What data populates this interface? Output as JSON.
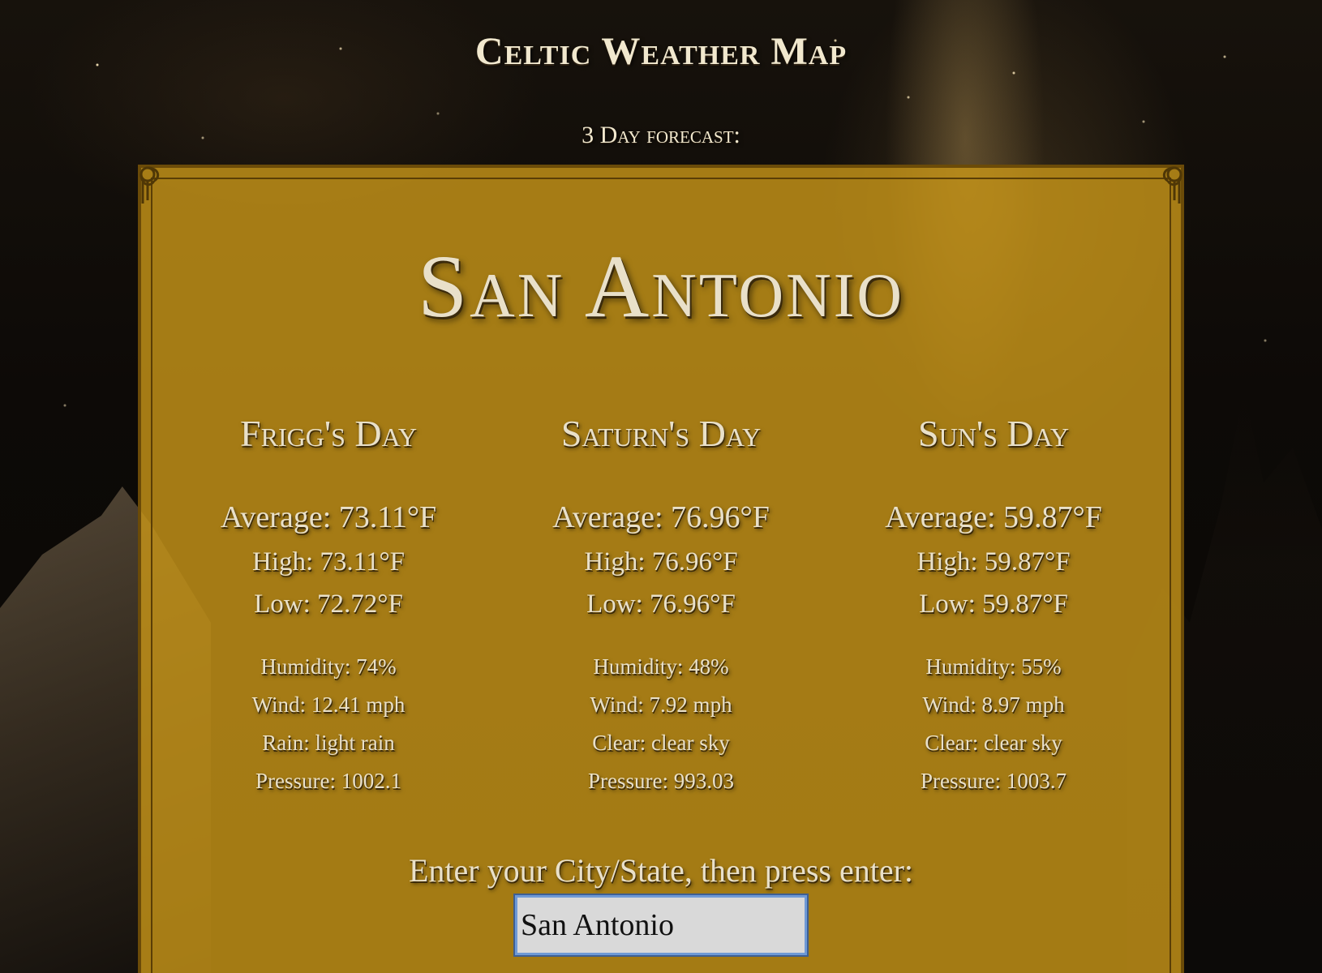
{
  "header": {
    "title": "Celtic Weather Map",
    "subtitle": "3 Day forecast:"
  },
  "city": {
    "name": "San Antonio"
  },
  "days": [
    {
      "name": "Frigg's Day",
      "average": "Average: 73.11°F",
      "high": "High: 73.11°F",
      "low": "Low: 72.72°F",
      "humidity": "Humidity: 74%",
      "wind": "Wind: 12.41 mph",
      "condition": "Rain: light rain",
      "pressure": "Pressure: 1002.1"
    },
    {
      "name": "Saturn's Day",
      "average": "Average: 76.96°F",
      "high": "High: 76.96°F",
      "low": "Low: 76.96°F",
      "humidity": "Humidity: 48%",
      "wind": "Wind: 7.92 mph",
      "condition": "Clear: clear sky",
      "pressure": "Pressure: 993.03"
    },
    {
      "name": "Sun's Day",
      "average": "Average: 59.87°F",
      "high": "High: 59.87°F",
      "low": "Low: 59.87°F",
      "humidity": "Humidity: 55%",
      "wind": "Wind: 8.97 mph",
      "condition": "Clear: clear sky",
      "pressure": "Pressure: 1003.7"
    }
  ],
  "search": {
    "prompt": "Enter your City/State, then press enter:",
    "value": "San Antonio"
  },
  "colors": {
    "panel": "#c79518",
    "text": "#e9e0c9",
    "input_border": "#6f9ad6"
  },
  "icons": {
    "corner_ornament": "celtic-knot-icon"
  }
}
